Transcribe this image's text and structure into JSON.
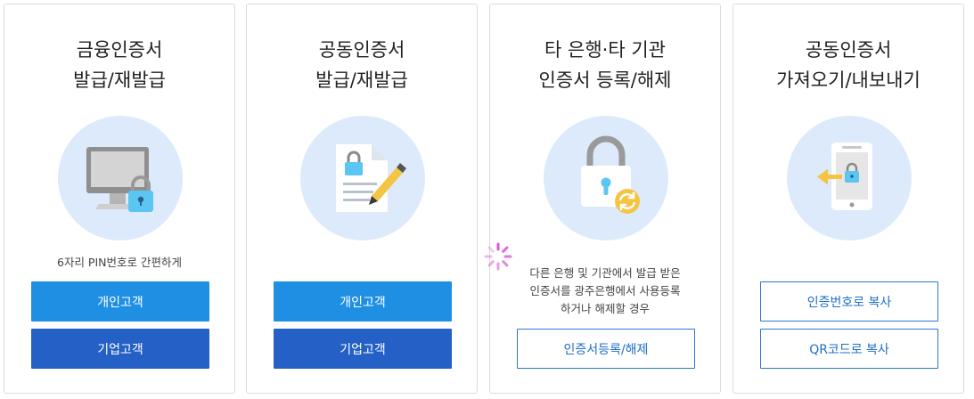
{
  "cards": [
    {
      "title_line1": "금융인증서",
      "title_line2": "발급/재발급",
      "illustration_icon": "computer-lock-icon",
      "note_lines": [
        "6자리 PIN번호로 간편하게"
      ],
      "buttons": [
        "개인고객",
        "기업고객"
      ]
    },
    {
      "title_line1": "공동인증서",
      "title_line2": "발급/재발급",
      "illustration_icon": "document-lock-pen-icon",
      "note_lines": [],
      "buttons": [
        "개인고객",
        "기업고객"
      ]
    },
    {
      "title_line1": "타 은행·타 기관",
      "title_line2": "인증서 등록/해제",
      "illustration_icon": "padlock-refresh-icon",
      "note_lines": [
        "다른 은행 및 기관에서 발급 받은",
        "인증서를 광주은행에서 사용등록",
        "하거나 해제할 경우"
      ],
      "buttons": [
        "인증서등록/해제"
      ]
    },
    {
      "title_line1": "공동인증서",
      "title_line2": "가져오기/내보내기",
      "illustration_icon": "phone-lock-arrow-icon",
      "note_lines": [],
      "buttons": [
        "인증번호로 복사",
        "QR코드로 복사"
      ]
    }
  ],
  "colors": {
    "primary_button": "#1f8fe3",
    "secondary_button": "#2460c6",
    "outline_button": "#2a76cf",
    "illustration_bg": "#ddeafc",
    "lock_blue": "#5bc6f2",
    "refresh_yellow": "#f5c542",
    "spinner": "#d45ad8"
  },
  "loading_indicator_icon": "loading-spinner-icon"
}
